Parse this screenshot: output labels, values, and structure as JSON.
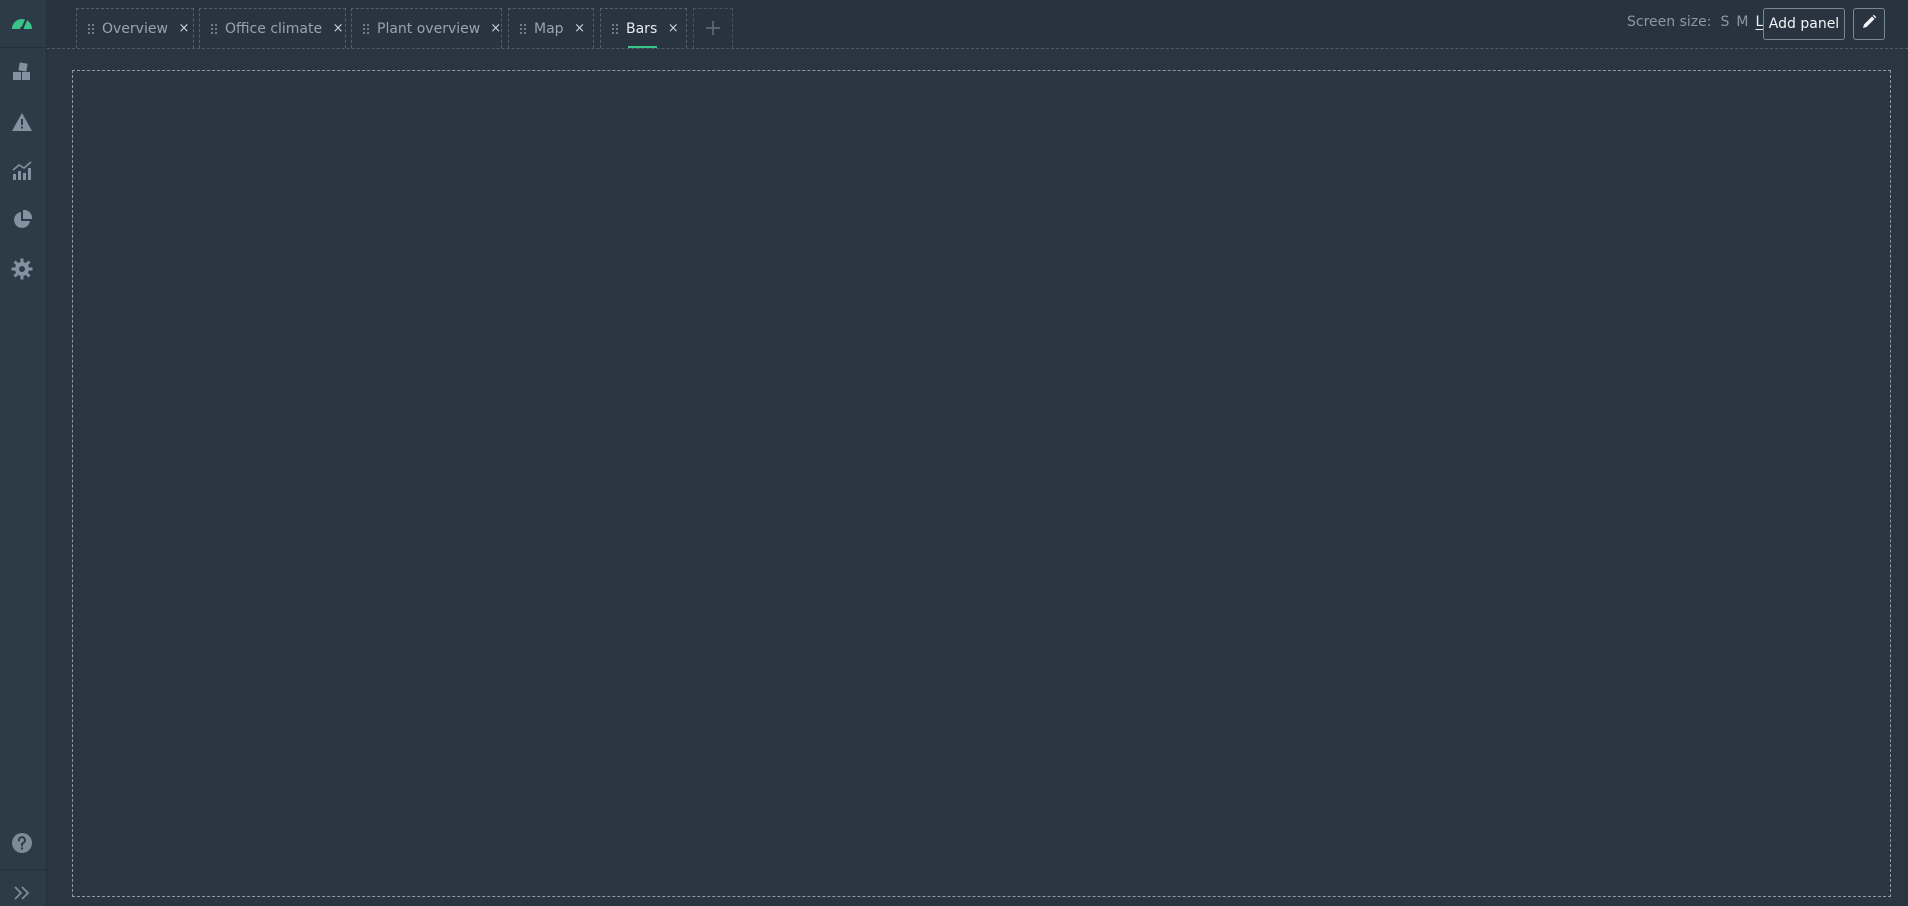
{
  "sidebar": {
    "items": [
      {
        "icon": "dashboard-gauge-icon",
        "color": "#39c58a"
      },
      {
        "icon": "blocks-icon"
      },
      {
        "icon": "warning-triangle-icon"
      },
      {
        "icon": "bar-line-chart-icon"
      },
      {
        "icon": "pie-chart-icon"
      },
      {
        "icon": "gear-icon"
      },
      {
        "icon": "help-circle-icon"
      },
      {
        "icon": "expand-chevrons-icon"
      }
    ]
  },
  "tabs": [
    {
      "label": "Overview",
      "close": "×"
    },
    {
      "label": "Office climate",
      "close": "×"
    },
    {
      "label": "Plant overview",
      "close": "×"
    },
    {
      "label": "Map",
      "close": "×"
    },
    {
      "label": "Bars",
      "close": "×",
      "active": true
    }
  ],
  "add_tab_label": "+",
  "toolbar": {
    "screen_size_label": "Screen size:",
    "sizes": [
      "S",
      "M",
      "L"
    ],
    "selected_size": "L",
    "add_panel_label": "Add panel",
    "edit_icon": "pencil-icon"
  },
  "colors": {
    "accent": "#39c58a",
    "background": "#2a3542",
    "sidebar": "#2d3b47"
  }
}
